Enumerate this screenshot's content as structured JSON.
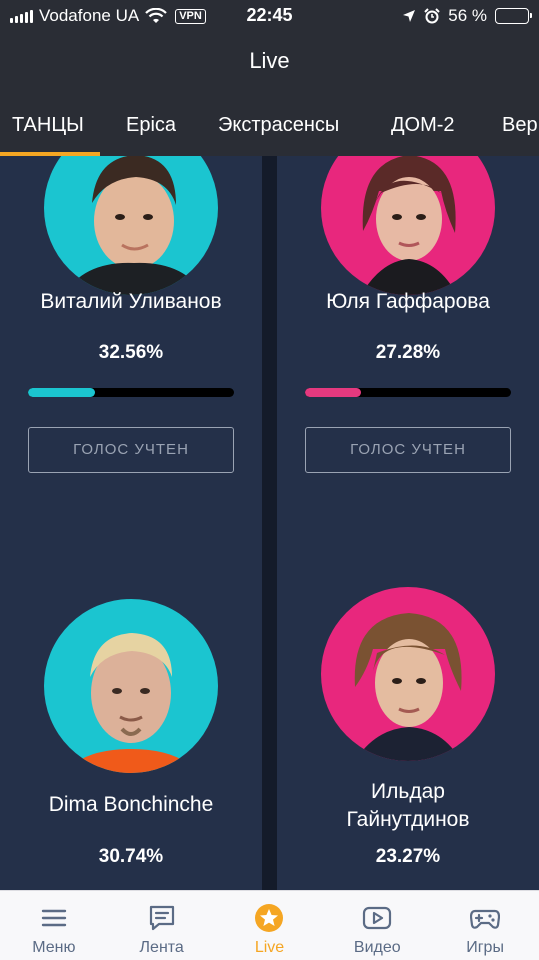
{
  "status_bar": {
    "carrier": "Vodafone UA",
    "vpn": "VPN",
    "time": "22:45",
    "battery_percent": "56 %",
    "battery_level": 0.56
  },
  "header": {
    "title": "Live"
  },
  "tabs": [
    {
      "label": "ТАНЦЫ",
      "active": true
    },
    {
      "label": "Epica",
      "active": false
    },
    {
      "label": "Экстрасенсы",
      "active": false
    },
    {
      "label": "ДОМ-2",
      "active": false
    },
    {
      "label": "Вер",
      "active": false
    }
  ],
  "contestants": [
    {
      "name": "Виталий Уливанов",
      "percent": "32.56%",
      "share": 0.3256,
      "bar_color": "#1bc5d0",
      "avatar_bg": "#1bc5d0",
      "vote_label": "ГОЛОС УЧТЕН"
    },
    {
      "name": "Юля Гаффарова",
      "percent": "27.28%",
      "share": 0.2728,
      "bar_color": "#e5397f",
      "avatar_bg": "#e8277d",
      "vote_label": "ГОЛОС УЧТЕН"
    },
    {
      "name": "Dima Bonchinche",
      "percent": "30.74%",
      "share": 0.3074,
      "avatar_bg": "#1bc5d0"
    },
    {
      "name": "Ильдар Гайнутдинов",
      "percent": "23.27%",
      "share": 0.2327,
      "avatar_bg": "#e8277d"
    }
  ],
  "bottom_nav": [
    {
      "label": "Меню",
      "icon": "menu-icon"
    },
    {
      "label": "Лента",
      "icon": "feed-icon"
    },
    {
      "label": "Live",
      "icon": "star-icon",
      "active": true
    },
    {
      "label": "Видео",
      "icon": "video-icon"
    },
    {
      "label": "Игры",
      "icon": "gamepad-icon"
    }
  ],
  "colors": {
    "accent": "#f5a623",
    "card": "#243049",
    "background": "#141b2a",
    "nav_inactive": "#5b6b85"
  }
}
